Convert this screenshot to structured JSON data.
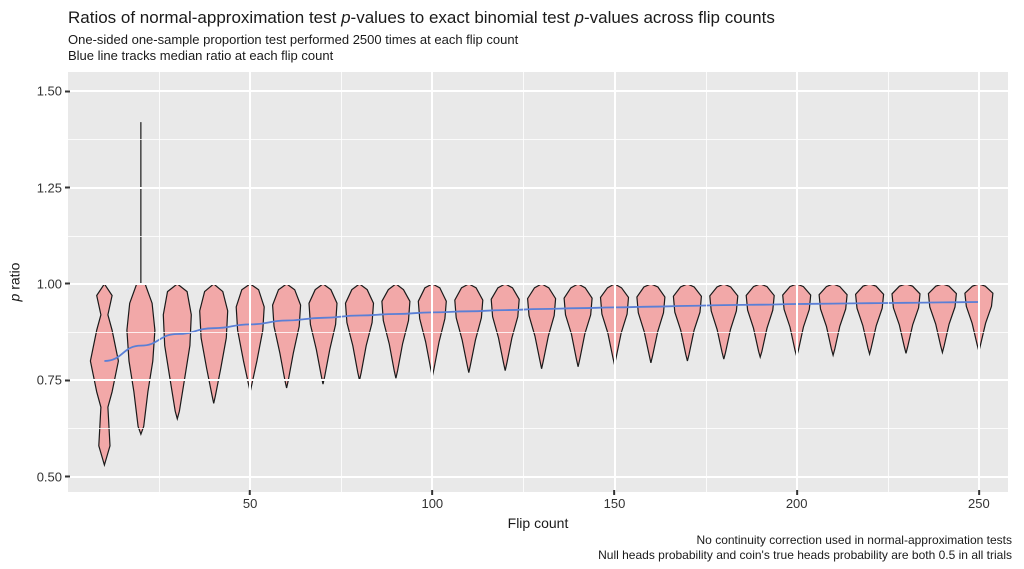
{
  "title_parts": {
    "pre": "Ratios of normal-approximation test ",
    "p1": "p",
    "mid1": "-values to exact binomial test ",
    "p2": "p",
    "post": "-values across flip counts"
  },
  "subtitle": "One-sided one-sample proportion test performed 2500 times at each flip count\nBlue line tracks median ratio at each flip count",
  "caption": "No continuity correction used in normal-approximation tests\nNull heads probability and coin's true heads probability are both 0.5 in all trials",
  "xlabel": "Flip count",
  "ylabel_parts": {
    "p": "p",
    "rest": " ratio"
  },
  "axes": {
    "x": {
      "min": 0,
      "max": 258,
      "ticks": [
        50,
        100,
        150,
        200,
        250
      ],
      "minor": [
        25,
        75,
        125,
        175,
        225
      ]
    },
    "y": {
      "min": 0.46,
      "max": 1.55,
      "ticks": [
        0.5,
        0.75,
        1.0,
        1.25,
        1.5
      ],
      "minor": [
        0.625,
        0.875,
        1.125,
        1.375
      ]
    }
  },
  "chart_data": {
    "type": "violin",
    "title": "Ratios of normal-approximation test p-values to exact binomial test p-values across flip counts",
    "xlabel": "Flip count",
    "ylabel": "p ratio",
    "xlim": [
      0,
      258
    ],
    "ylim": [
      0.46,
      1.55
    ],
    "x": [
      10,
      20,
      30,
      40,
      50,
      60,
      70,
      80,
      90,
      100,
      110,
      120,
      130,
      140,
      150,
      160,
      170,
      180,
      190,
      200,
      210,
      220,
      230,
      240,
      250
    ],
    "median_series": {
      "name": "Median p ratio",
      "values": [
        0.8,
        0.84,
        0.87,
        0.885,
        0.895,
        0.905,
        0.912,
        0.918,
        0.922,
        0.926,
        0.929,
        0.932,
        0.935,
        0.937,
        0.939,
        0.941,
        0.943,
        0.945,
        0.946,
        0.948,
        0.949,
        0.95,
        0.951,
        0.952,
        0.953
      ]
    },
    "violins": [
      {
        "x": 10,
        "min": 0.53,
        "max": 1.0,
        "widths": [
          [
            0.58,
            0.4
          ],
          [
            0.68,
            0.25
          ],
          [
            0.72,
            0.55
          ],
          [
            0.8,
            1.0
          ],
          [
            0.88,
            0.55
          ],
          [
            0.92,
            0.25
          ],
          [
            0.97,
            0.55
          ]
        ]
      },
      {
        "x": 20,
        "min": 0.61,
        "max": 1.42,
        "widths": [
          [
            0.63,
            0.2
          ],
          [
            0.72,
            0.5
          ],
          [
            0.8,
            0.85
          ],
          [
            0.88,
            1.0
          ],
          [
            0.95,
            0.8
          ],
          [
            1.0,
            0.3
          ]
        ],
        "spike_to": 1.42
      },
      {
        "x": 30,
        "min": 0.65,
        "max": 1.0,
        "widths": [
          [
            0.67,
            0.15
          ],
          [
            0.76,
            0.55
          ],
          [
            0.84,
            0.9
          ],
          [
            0.92,
            1.0
          ],
          [
            0.98,
            0.7
          ]
        ]
      },
      {
        "x": 40,
        "min": 0.69,
        "max": 1.0,
        "widths": [
          [
            0.71,
            0.12
          ],
          [
            0.78,
            0.5
          ],
          [
            0.86,
            0.9
          ],
          [
            0.93,
            1.0
          ],
          [
            0.98,
            0.65
          ]
        ]
      },
      {
        "x": 50,
        "min": 0.72,
        "max": 1.0,
        "widths": [
          [
            0.74,
            0.12
          ],
          [
            0.8,
            0.48
          ],
          [
            0.88,
            0.9
          ],
          [
            0.94,
            1.0
          ],
          [
            0.985,
            0.6
          ]
        ]
      },
      {
        "x": 60,
        "min": 0.73,
        "max": 1.0,
        "widths": [
          [
            0.75,
            0.12
          ],
          [
            0.82,
            0.48
          ],
          [
            0.89,
            0.9
          ],
          [
            0.945,
            1.0
          ],
          [
            0.985,
            0.58
          ]
        ]
      },
      {
        "x": 70,
        "min": 0.74,
        "max": 1.0,
        "widths": [
          [
            0.76,
            0.12
          ],
          [
            0.83,
            0.48
          ],
          [
            0.895,
            0.9
          ],
          [
            0.95,
            1.0
          ],
          [
            0.985,
            0.56
          ]
        ]
      },
      {
        "x": 80,
        "min": 0.75,
        "max": 1.0,
        "widths": [
          [
            0.77,
            0.12
          ],
          [
            0.84,
            0.48
          ],
          [
            0.9,
            0.9
          ],
          [
            0.95,
            1.0
          ],
          [
            0.985,
            0.55
          ]
        ]
      },
      {
        "x": 90,
        "min": 0.755,
        "max": 1.0,
        "widths": [
          [
            0.775,
            0.12
          ],
          [
            0.845,
            0.48
          ],
          [
            0.905,
            0.9
          ],
          [
            0.955,
            1.0
          ],
          [
            0.985,
            0.54
          ]
        ]
      },
      {
        "x": 100,
        "min": 0.76,
        "max": 1.0,
        "widths": [
          [
            0.78,
            0.12
          ],
          [
            0.85,
            0.48
          ],
          [
            0.91,
            0.9
          ],
          [
            0.955,
            1.0
          ],
          [
            0.99,
            0.53
          ]
        ]
      },
      {
        "x": 110,
        "min": 0.77,
        "max": 1.0,
        "widths": [
          [
            0.79,
            0.12
          ],
          [
            0.855,
            0.48
          ],
          [
            0.912,
            0.9
          ],
          [
            0.958,
            1.0
          ],
          [
            0.99,
            0.52
          ]
        ]
      },
      {
        "x": 120,
        "min": 0.775,
        "max": 1.0,
        "widths": [
          [
            0.795,
            0.12
          ],
          [
            0.86,
            0.48
          ],
          [
            0.915,
            0.9
          ],
          [
            0.96,
            1.0
          ],
          [
            0.99,
            0.52
          ]
        ]
      },
      {
        "x": 130,
        "min": 0.78,
        "max": 1.0,
        "widths": [
          [
            0.8,
            0.12
          ],
          [
            0.865,
            0.48
          ],
          [
            0.918,
            0.9
          ],
          [
            0.962,
            1.0
          ],
          [
            0.99,
            0.51
          ]
        ]
      },
      {
        "x": 140,
        "min": 0.785,
        "max": 1.0,
        "widths": [
          [
            0.805,
            0.12
          ],
          [
            0.87,
            0.48
          ],
          [
            0.92,
            0.9
          ],
          [
            0.963,
            1.0
          ],
          [
            0.99,
            0.51
          ]
        ]
      },
      {
        "x": 150,
        "min": 0.79,
        "max": 1.0,
        "widths": [
          [
            0.81,
            0.12
          ],
          [
            0.873,
            0.48
          ],
          [
            0.922,
            0.9
          ],
          [
            0.965,
            1.0
          ],
          [
            0.99,
            0.5
          ]
        ]
      },
      {
        "x": 160,
        "min": 0.795,
        "max": 1.0,
        "widths": [
          [
            0.814,
            0.12
          ],
          [
            0.876,
            0.48
          ],
          [
            0.925,
            0.9
          ],
          [
            0.966,
            1.0
          ],
          [
            0.992,
            0.5
          ]
        ]
      },
      {
        "x": 170,
        "min": 0.8,
        "max": 1.0,
        "widths": [
          [
            0.818,
            0.12
          ],
          [
            0.88,
            0.48
          ],
          [
            0.927,
            0.9
          ],
          [
            0.968,
            1.0
          ],
          [
            0.992,
            0.49
          ]
        ]
      },
      {
        "x": 180,
        "min": 0.805,
        "max": 1.0,
        "widths": [
          [
            0.822,
            0.12
          ],
          [
            0.882,
            0.48
          ],
          [
            0.93,
            0.9
          ],
          [
            0.969,
            1.0
          ],
          [
            0.992,
            0.49
          ]
        ]
      },
      {
        "x": 190,
        "min": 0.81,
        "max": 1.0,
        "widths": [
          [
            0.825,
            0.12
          ],
          [
            0.885,
            0.48
          ],
          [
            0.932,
            0.9
          ],
          [
            0.97,
            1.0
          ],
          [
            0.993,
            0.48
          ]
        ]
      },
      {
        "x": 200,
        "min": 0.812,
        "max": 1.0,
        "widths": [
          [
            0.828,
            0.12
          ],
          [
            0.888,
            0.48
          ],
          [
            0.934,
            0.9
          ],
          [
            0.971,
            1.0
          ],
          [
            0.993,
            0.48
          ]
        ]
      },
      {
        "x": 210,
        "min": 0.815,
        "max": 1.0,
        "widths": [
          [
            0.831,
            0.12
          ],
          [
            0.89,
            0.48
          ],
          [
            0.935,
            0.9
          ],
          [
            0.972,
            1.0
          ],
          [
            0.993,
            0.48
          ]
        ]
      },
      {
        "x": 220,
        "min": 0.818,
        "max": 1.0,
        "widths": [
          [
            0.834,
            0.12
          ],
          [
            0.892,
            0.48
          ],
          [
            0.937,
            0.9
          ],
          [
            0.973,
            1.0
          ],
          [
            0.994,
            0.47
          ]
        ]
      },
      {
        "x": 230,
        "min": 0.82,
        "max": 1.0,
        "widths": [
          [
            0.837,
            0.12
          ],
          [
            0.894,
            0.48
          ],
          [
            0.938,
            0.9
          ],
          [
            0.974,
            1.0
          ],
          [
            0.994,
            0.47
          ]
        ]
      },
      {
        "x": 240,
        "min": 0.822,
        "max": 1.0,
        "widths": [
          [
            0.839,
            0.12
          ],
          [
            0.896,
            0.48
          ],
          [
            0.94,
            0.9
          ],
          [
            0.975,
            1.0
          ],
          [
            0.994,
            0.47
          ]
        ]
      },
      {
        "x": 250,
        "min": 0.825,
        "max": 1.0,
        "widths": [
          [
            0.842,
            0.12
          ],
          [
            0.898,
            0.48
          ],
          [
            0.942,
            0.9
          ],
          [
            0.976,
            1.0
          ],
          [
            0.994,
            0.46
          ]
        ]
      }
    ]
  }
}
